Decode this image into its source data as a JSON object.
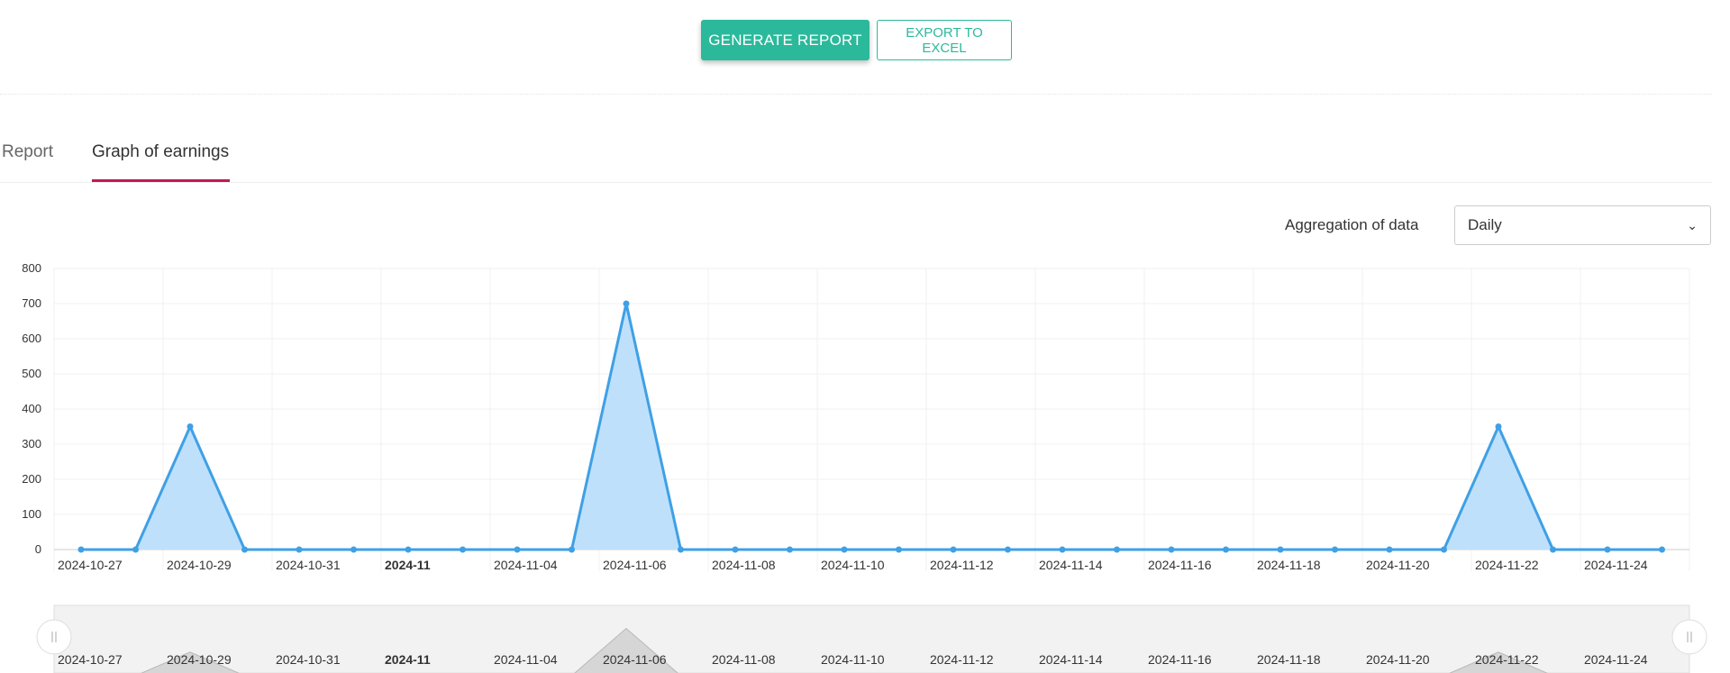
{
  "toolbar": {
    "generate_label": "GENERATE REPORT",
    "export_label": "EXPORT TO EXCEL"
  },
  "tabs": [
    {
      "label": "Report",
      "active": false
    },
    {
      "label": "Graph of earnings",
      "active": true
    }
  ],
  "aggregation": {
    "label": "Aggregation of data",
    "selected": "Daily"
  },
  "colors": {
    "accent": "#2bb99b",
    "tab_underline": "#c2185b",
    "series_line": "#3fa0e6",
    "series_fill": "#bfe0fb",
    "navigator_fill": "#d6d6d6"
  },
  "chart_data": {
    "type": "area",
    "title": "",
    "xlabel": "",
    "ylabel": "",
    "ylim": [
      0,
      800
    ],
    "yticks": [
      0,
      100,
      200,
      300,
      400,
      500,
      600,
      700,
      800
    ],
    "grid": true,
    "x": [
      "2024-10-27",
      "2024-10-28",
      "2024-10-29",
      "2024-10-30",
      "2024-10-31",
      "2024-11-01",
      "2024-11-02",
      "2024-11-03",
      "2024-11-04",
      "2024-11-05",
      "2024-11-06",
      "2024-11-07",
      "2024-11-08",
      "2024-11-09",
      "2024-11-10",
      "2024-11-11",
      "2024-11-12",
      "2024-11-13",
      "2024-11-14",
      "2024-11-15",
      "2024-11-16",
      "2024-11-17",
      "2024-11-18",
      "2024-11-19",
      "2024-11-20",
      "2024-11-21",
      "2024-11-22",
      "2024-11-23",
      "2024-11-24",
      "2024-11-25"
    ],
    "series": [
      {
        "values": [
          0,
          0,
          350,
          0,
          0,
          0,
          0,
          0,
          0,
          0,
          700,
          0,
          0,
          0,
          0,
          0,
          0,
          0,
          0,
          0,
          0,
          0,
          0,
          0,
          0,
          0,
          350,
          0,
          0,
          0
        ]
      }
    ],
    "tick_labels": [
      {
        "label": "2024-10-27",
        "bold": false
      },
      {
        "label": "2024-10-29",
        "bold": false
      },
      {
        "label": "2024-10-31",
        "bold": false
      },
      {
        "label": "2024-11",
        "bold": true
      },
      {
        "label": "2024-11-04",
        "bold": false
      },
      {
        "label": "2024-11-06",
        "bold": false
      },
      {
        "label": "2024-11-08",
        "bold": false
      },
      {
        "label": "2024-11-10",
        "bold": false
      },
      {
        "label": "2024-11-12",
        "bold": false
      },
      {
        "label": "2024-11-14",
        "bold": false
      },
      {
        "label": "2024-11-16",
        "bold": false
      },
      {
        "label": "2024-11-18",
        "bold": false
      },
      {
        "label": "2024-11-20",
        "bold": false
      },
      {
        "label": "2024-11-22",
        "bold": false
      },
      {
        "label": "2024-11-24",
        "bold": false
      }
    ],
    "navigator": true
  }
}
